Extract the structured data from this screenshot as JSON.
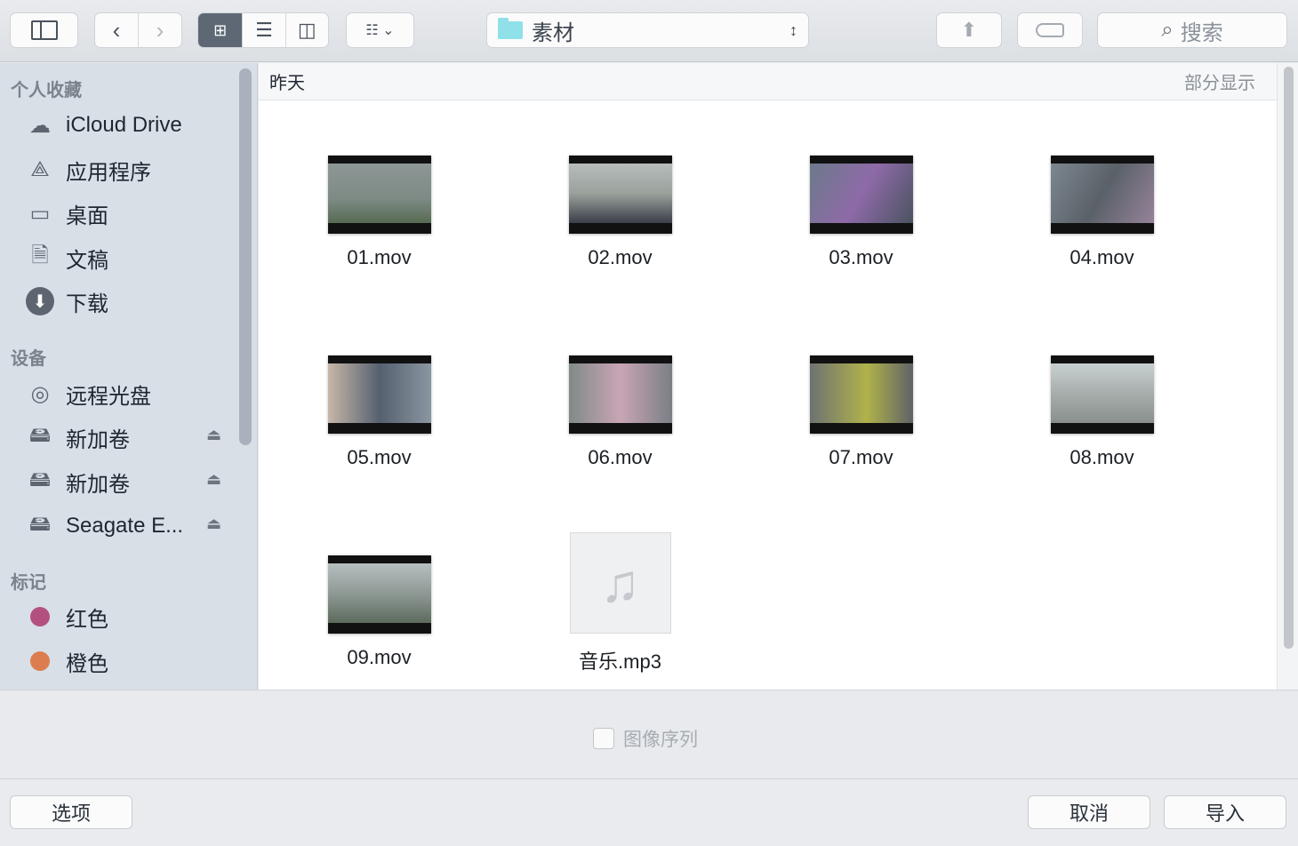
{
  "toolbar": {
    "path": "素材",
    "search_placeholder": "搜索"
  },
  "sidebar": {
    "favorites_header": "个人收藏",
    "favorites": [
      {
        "label": "iCloud Drive"
      },
      {
        "label": "应用程序"
      },
      {
        "label": "桌面"
      },
      {
        "label": "文稿"
      },
      {
        "label": "下载"
      }
    ],
    "devices_header": "设备",
    "devices": [
      {
        "label": "远程光盘"
      },
      {
        "label": "新加卷"
      },
      {
        "label": "新加卷"
      },
      {
        "label": "Seagate E..."
      }
    ],
    "tags_header": "标记",
    "tags": [
      {
        "label": "红色",
        "color": "#b3507f"
      },
      {
        "label": "橙色",
        "color": "#dc7d4f"
      }
    ]
  },
  "content": {
    "group": "昨天",
    "show_less": "部分显示",
    "files": [
      {
        "name": "01.mov"
      },
      {
        "name": "02.mov"
      },
      {
        "name": "03.mov"
      },
      {
        "name": "04.mov"
      },
      {
        "name": "05.mov"
      },
      {
        "name": "06.mov"
      },
      {
        "name": "07.mov"
      },
      {
        "name": "08.mov"
      },
      {
        "name": "09.mov"
      },
      {
        "name": "音乐.mp3"
      }
    ]
  },
  "options": {
    "image_sequence": "图像序列"
  },
  "footer": {
    "options": "选项",
    "cancel": "取消",
    "import": "导入"
  }
}
